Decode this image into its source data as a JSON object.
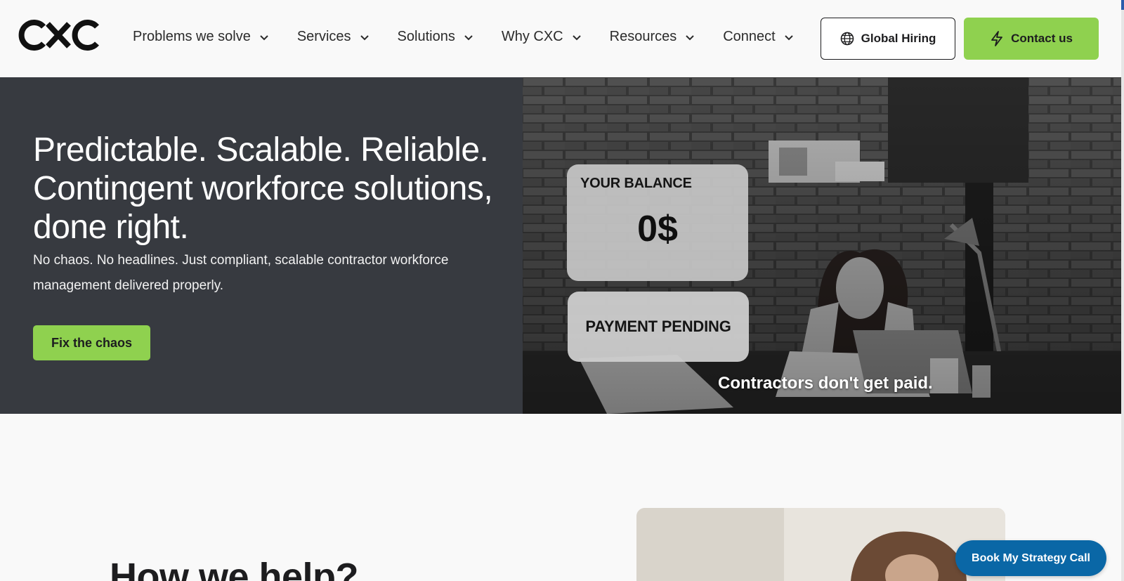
{
  "brand": {
    "logo_text": "CXC"
  },
  "nav": {
    "items": [
      {
        "label": "Problems we solve"
      },
      {
        "label": "Services"
      },
      {
        "label": "Solutions"
      },
      {
        "label": "Why CXC"
      },
      {
        "label": "Resources"
      },
      {
        "label": "Connect"
      }
    ]
  },
  "header_buttons": {
    "global_hiring": "Global Hiring",
    "contact": "Contact us"
  },
  "hero": {
    "title_line1": "Predictable. Scalable. Reliable.",
    "title_line2": "Contingent workforce solutions,",
    "title_line3": "done right.",
    "subtitle": "No chaos. No headlines. Just compliant, scalable contractor workforce management delivered properly.",
    "cta": "Fix the chaos",
    "balance_label": "YOUR BALANCE",
    "balance_value": "0$",
    "pending_label": "PAYMENT PENDING",
    "caption": "Contractors don't get paid."
  },
  "help": {
    "title": "How we help?"
  },
  "floating": {
    "strategy_call": "Book My Strategy Call"
  },
  "colors": {
    "accent_green": "#8fd14f",
    "hero_dark": "#373a40",
    "cta_blue": "#0a67a6"
  }
}
